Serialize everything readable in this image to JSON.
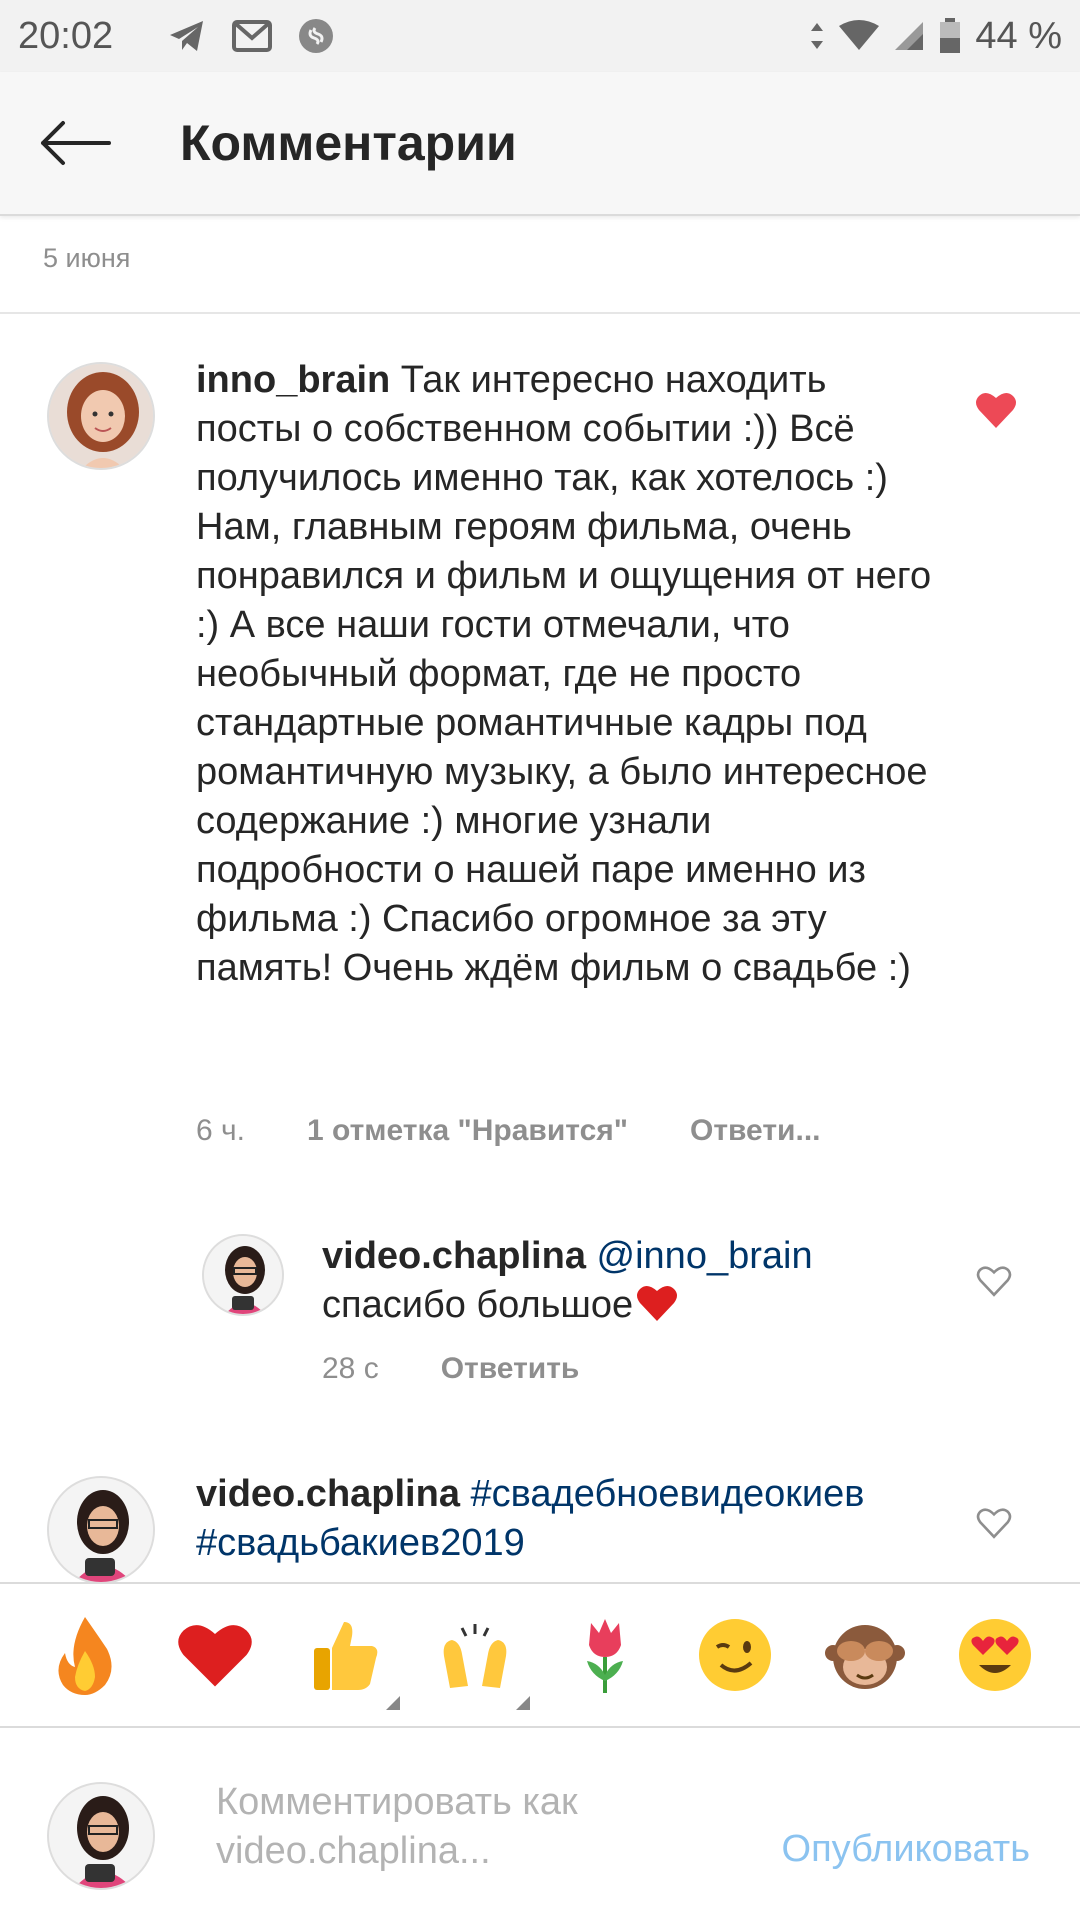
{
  "status_bar": {
    "time": "20:02",
    "battery": "44 %",
    "icons": [
      "telegram-icon",
      "gmail-icon",
      "shazam-icon",
      "data-arrows-icon",
      "wifi-icon",
      "signal-icon",
      "battery-icon"
    ]
  },
  "header": {
    "title": "Комментарии"
  },
  "caption": {
    "date": "5 июня"
  },
  "comments": [
    {
      "username": "inno_brain",
      "text": "Так интересно находить посты о собственном событии :)) Всё получилось именно так, как хотелось :) Нам, главным героям фильма, очень понравился и фильм и ощущения от него :) А все наши гости отмечали, что необычный формат, где не просто стандартные романтичные кадры под романтичную музыку, а было интересное содержание :) многие узнали подробности о нашей паре именно из фильма :) Спасибо огромное за эту память! Очень ждём фильм о свадьбе :)",
      "time": "6 ч.",
      "likes": "1 отметка \"Нравится\"",
      "reply": "Ответи...",
      "liked": true
    },
    {
      "username": "video.chaplina",
      "mention": "@inno_brain",
      "text": "спасибо большое",
      "time": "28 с",
      "reply": "Ответить",
      "liked": false
    },
    {
      "username": "video.chaplina",
      "hashtags": "#свадебноевидеокиев #свадьбакиев2019",
      "liked": false
    }
  ],
  "emoji_bar": [
    "fire",
    "heart",
    "thumbs-up",
    "raising-hands",
    "tulip",
    "wink",
    "see-no-evil-monkey",
    "heart-eyes"
  ],
  "composer": {
    "placeholder": "Комментировать как video.chaplina...",
    "publish": "Опубликовать"
  },
  "colors": {
    "heart_liked": "#ed4956",
    "link": "#003569",
    "publish_disabled": "#8bc3f0"
  }
}
